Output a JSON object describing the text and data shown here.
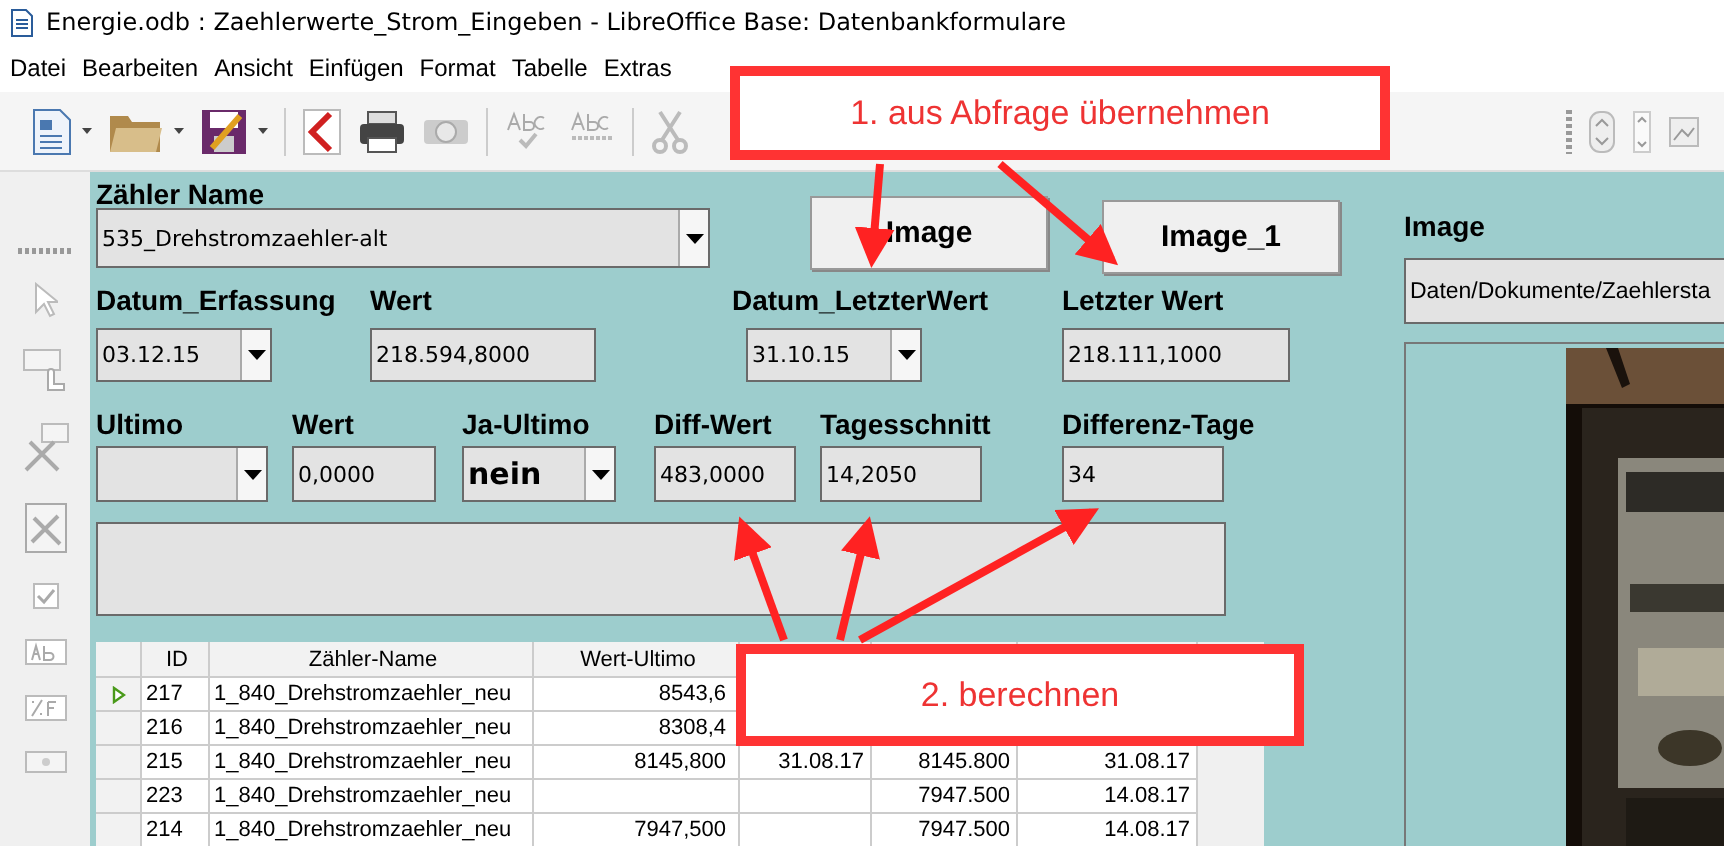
{
  "window": {
    "title": "Energie.odb : Zaehlerwerte_Strom_Eingeben - LibreOffice Base: Datenbankformulare"
  },
  "menu": [
    "Datei",
    "Bearbeiten",
    "Ansicht",
    "Einfügen",
    "Format",
    "Tabelle",
    "Extras"
  ],
  "zaehler_name": {
    "label": "Zähler Name",
    "value": "535_Drehstromzaehler-alt"
  },
  "buttons": [
    "Image",
    "Image_1"
  ],
  "image": {
    "label": "Image",
    "path": "Daten/Dokumente/Zaehlersta"
  },
  "fields": [
    {
      "label": "Datum_Erfassung",
      "value": "03.12.15",
      "kind": "date"
    },
    {
      "label": "Wert",
      "value": "218.594,8000",
      "kind": "text"
    },
    {
      "label": "Datum_LetzterWert",
      "value": "31.10.15",
      "kind": "date"
    },
    {
      "label": "Letzter Wert",
      "value": "218.111,1000",
      "kind": "text"
    },
    {
      "label": "Ultimo",
      "kind": "date"
    },
    {
      "label": "Wert",
      "value": "0,0000",
      "kind": "text"
    },
    {
      "label": "Ja-Ultimo",
      "value": "nein",
      "kind": "listbox"
    },
    {
      "label": "Diff-Wert",
      "value": "483,0000",
      "kind": "text"
    },
    {
      "label": "Tagesschnitt",
      "value": "14,2050",
      "kind": "text"
    },
    {
      "label": "Differenz-Tage",
      "value": "34",
      "kind": "text"
    }
  ],
  "table": {
    "columns": [
      "ID",
      "Zähler-Name",
      "Wert-Ultimo"
    ],
    "rows": [
      {
        "selected": true,
        "id": "217",
        "name": "1_840_Drehstromzaehler_neu",
        "wert_ultimo": "8543,6"
      },
      {
        "selected": false,
        "id": "216",
        "name": "1_840_Drehstromzaehler_neu",
        "wert_ultimo": "8308,4"
      },
      {
        "selected": false,
        "id": "215",
        "name": "1_840_Drehstromzaehler_neu",
        "wert_ultimo": "8145,800",
        "column_4": "31.08.17",
        "column_5": "8145.800",
        "column_6": "31.08.17"
      },
      {
        "selected": false,
        "id": "223",
        "name": "1_840_Drehstromzaehler_neu",
        "column_5": "7947.500",
        "column_6": "14.08.17"
      },
      {
        "selected": false,
        "id": "214",
        "name": "1_840_Drehstromzaehler_neu",
        "wert_ultimo": "7947,500",
        "column_5": "7947.500",
        "column_6": "14.08.17"
      }
    ]
  },
  "callouts": [
    "1. aus Abfrage übernehmen",
    "2. berechnen"
  ]
}
